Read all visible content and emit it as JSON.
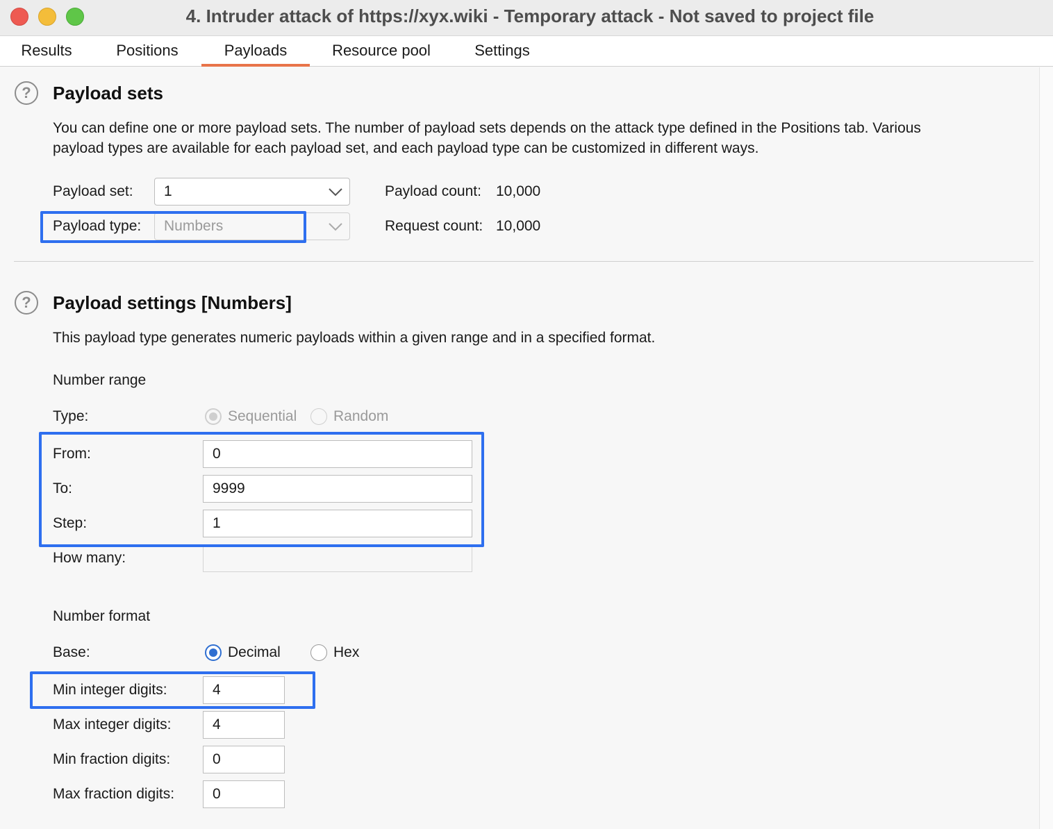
{
  "window": {
    "title": "4. Intruder attack of https://xyx.wiki - Temporary attack - Not saved to project file"
  },
  "tabs": [
    {
      "label": "Results"
    },
    {
      "label": "Positions"
    },
    {
      "label": "Payloads",
      "active": true
    },
    {
      "label": "Resource pool"
    },
    {
      "label": "Settings"
    }
  ],
  "payload_sets": {
    "title": "Payload sets",
    "description_line1": "You can define one or more payload sets. The number of payload sets depends on the attack type defined in the Positions tab. Various",
    "description_line2": "payload types are available for each payload set, and each payload type can be customized in different ways.",
    "payload_set_label": "Payload set:",
    "payload_set_value": "1",
    "payload_type_label": "Payload type:",
    "payload_type_value": "Numbers",
    "payload_count_label": "Payload count:",
    "payload_count_value": "10,000",
    "request_count_label": "Request count:",
    "request_count_value": "10,000"
  },
  "payload_settings": {
    "title": "Payload settings [Numbers]",
    "description": "This payload type generates numeric payloads within a given range and in a specified format.",
    "number_range": {
      "heading": "Number range",
      "type_label": "Type:",
      "type_options": [
        "Sequential",
        "Random"
      ],
      "type_selected": "Sequential",
      "from_label": "From:",
      "from_value": "0",
      "to_label": "To:",
      "to_value": "9999",
      "step_label": "Step:",
      "step_value": "1",
      "how_many_label": "How many:",
      "how_many_value": ""
    },
    "number_format": {
      "heading": "Number format",
      "base_label": "Base:",
      "base_options": [
        "Decimal",
        "Hex"
      ],
      "base_selected": "Decimal",
      "min_integer_label": "Min integer digits:",
      "min_integer_value": "4",
      "max_integer_label": "Max integer digits:",
      "max_integer_value": "4",
      "min_fraction_label": "Min fraction digits:",
      "min_fraction_value": "0",
      "max_fraction_label": "Max fraction digits:",
      "max_fraction_value": "0"
    }
  },
  "colors": {
    "accent_tab": "#e8744a",
    "highlight": "#2e6fef",
    "radio_selected": "#2f6fd1"
  }
}
